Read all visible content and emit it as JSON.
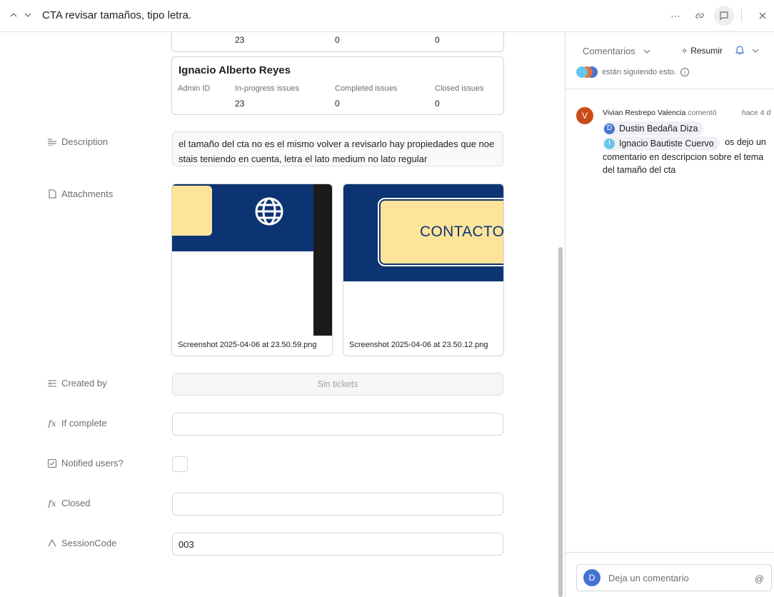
{
  "header": {
    "title": "CTA revisar tamaños, tipo letra."
  },
  "cards": [
    {
      "name": "",
      "values": [
        "23",
        "0",
        "0"
      ]
    },
    {
      "name": "Ignacio Alberto Reyes",
      "headers": [
        "Admin ID",
        "In-progress issues",
        "Completed issues",
        "Closed issues"
      ],
      "values": [
        "23",
        "0",
        "0"
      ]
    }
  ],
  "fields": {
    "description_label": "Description",
    "description_text": "el tamaño del cta no es el mismo volver a revisarlo hay propiedades que noe stais teniendo en cuenta, letra el lato medium no lato regular",
    "attachments_label": "Attachments",
    "attachments": [
      {
        "filename": "Screenshot 2025-04-06 at 23.50.59.png"
      },
      {
        "filename": "Screenshot 2025-04-06 at 23.50.12.png",
        "preview_text": "CONTACTO"
      }
    ],
    "created_by_label": "Created by",
    "created_by_value": "Sin tickets",
    "if_complete_label": "If complete",
    "if_complete_value": "",
    "notified_label": "Notified users?",
    "notified_checked": false,
    "closed_label": "Closed",
    "closed_value": "",
    "session_label": "SessionCode",
    "session_value": "003"
  },
  "comments_panel": {
    "tab_label": "Comentarios",
    "summarize_label": "Resumir",
    "followers_text": "están siguiendo esto.",
    "comment": {
      "avatar_letter": "V",
      "author": "Vivian Restrepo Valencia",
      "action": "comentó",
      "time": "hace 4 d",
      "mention1_letter": "D",
      "mention1": "Dustin Bedaña Diza",
      "mention2_letter": "I",
      "mention2": "Ignacio Bautiste Cuervo",
      "body_inline": "os dejo un",
      "body_rest": "comentario en descripcion sobre el tema del tamaño del cta"
    },
    "input_avatar_letter": "D",
    "input_placeholder": "Deja un comentario"
  },
  "colors": {
    "accent": "#4573d2",
    "navy": "#0d3472",
    "cta_yellow": "#fde49a",
    "comment_avatar": "#c94b16"
  }
}
